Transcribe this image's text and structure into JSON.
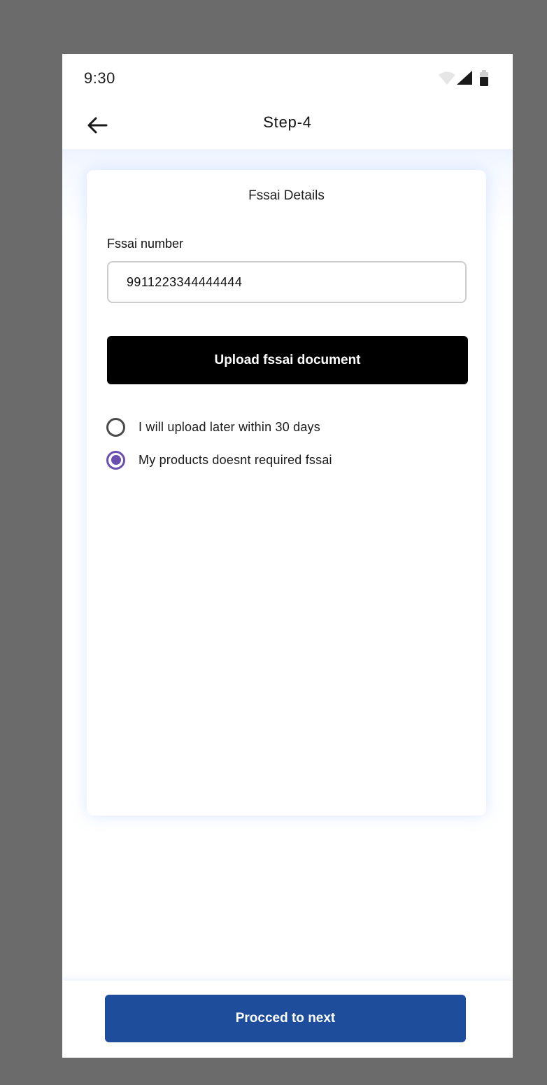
{
  "status_bar": {
    "time": "9:30",
    "icons": [
      "wifi-icon",
      "cellular-signal-icon",
      "battery-icon"
    ]
  },
  "app_bar": {
    "back_icon": "arrow-left-icon",
    "title": "Step-4"
  },
  "card": {
    "title": "Fssai Details",
    "fssai_number_label": "Fssai number",
    "fssai_number_value": "9911223344444444",
    "upload_button_label": "Upload fssai document",
    "radio_options": [
      {
        "label": "I will upload later within 30 days",
        "selected": false
      },
      {
        "label": "My products doesnt required fssai",
        "selected": true
      }
    ]
  },
  "footer": {
    "proceed_button_label": "Procced to next"
  },
  "colors": {
    "backdrop": "#6b6b6b",
    "primary_button": "#1e4d9b",
    "upload_button": "#000000",
    "radio_accent": "#6a4fb0"
  }
}
